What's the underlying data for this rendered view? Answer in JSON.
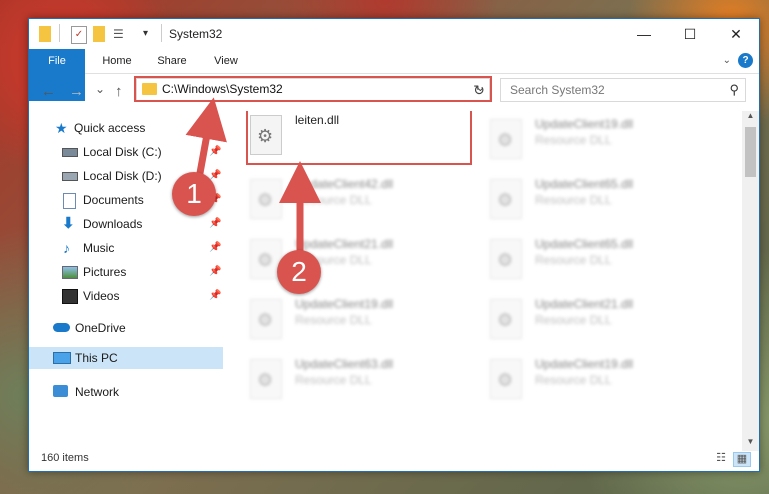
{
  "window": {
    "title": "System32",
    "minimize": "—",
    "maximize": "☐",
    "close": "✕"
  },
  "ribbon": {
    "tabs": [
      "File",
      "Home",
      "Share",
      "View"
    ],
    "help": "?"
  },
  "nav": {
    "back": "←",
    "forward": "→",
    "recent": "⌄",
    "up": "↑",
    "address": "C:\\Windows\\System32",
    "address_dropdown": "⌄",
    "refresh": "↻",
    "search_placeholder": "Search System32",
    "search_icon": "⚲"
  },
  "sidebar": {
    "items": [
      {
        "label": "Quick access",
        "icon": "star-icon",
        "pinned": false
      },
      {
        "label": "Local Disk (C:)",
        "icon": "drive-icon",
        "pinned": true
      },
      {
        "label": "Local Disk (D:)",
        "icon": "drive-icon",
        "pinned": true
      },
      {
        "label": "Documents",
        "icon": "documents-icon",
        "pinned": true
      },
      {
        "label": "Downloads",
        "icon": "downloads-icon",
        "pinned": true
      },
      {
        "label": "Music",
        "icon": "music-icon",
        "pinned": true
      },
      {
        "label": "Pictures",
        "icon": "pictures-icon",
        "pinned": true
      },
      {
        "label": "Videos",
        "icon": "videos-icon",
        "pinned": true
      },
      {
        "label": "OneDrive",
        "icon": "cloud-icon",
        "pinned": false
      },
      {
        "label": "This PC",
        "icon": "pc-icon",
        "pinned": false,
        "selected": true
      },
      {
        "label": "Network",
        "icon": "network-icon",
        "pinned": false
      }
    ],
    "pin_glyph": "📌"
  },
  "files": [
    {
      "name": "leiten.dll",
      "type": "",
      "highlighted": true
    },
    {
      "name": "UpdateClient19.dll",
      "type": "Resource DLL"
    },
    {
      "name": "UpdateClient42.dll",
      "type": "Resource DLL"
    },
    {
      "name": "UpdateClient65.dll",
      "type": "Resource DLL"
    },
    {
      "name": "UpdateClient21.dll",
      "type": "Resource DLL"
    },
    {
      "name": "UpdateClient65.dll",
      "type": "Resource DLL"
    },
    {
      "name": "UpdateClient19.dll",
      "type": "Resource DLL"
    },
    {
      "name": "UpdateClient21.dll",
      "type": "Resource DLL"
    },
    {
      "name": "UpdateClient63.dll",
      "type": "Resource DLL"
    },
    {
      "name": "UpdateClient19.dll",
      "type": "Resource DLL"
    }
  ],
  "status": {
    "item_count": "160 items"
  },
  "callouts": [
    "1",
    "2"
  ],
  "colors": {
    "accent": "#1979ca",
    "highlight": "#d9534f"
  }
}
